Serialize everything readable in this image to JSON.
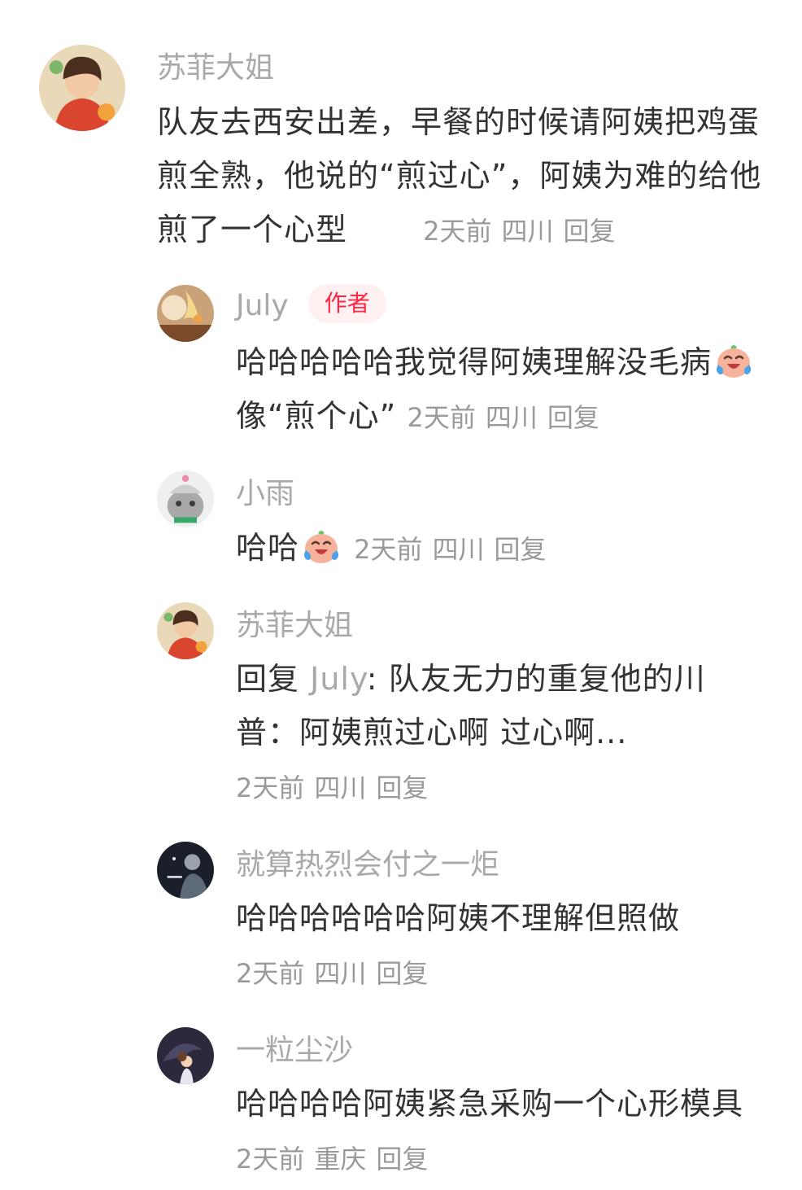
{
  "comments": [
    {
      "username": "苏菲大姐",
      "text": "队友去西安出差，早餐的时候请阿姨把鸡蛋煎全熟，他说的“煎过心”，阿姨为难的给他煎了一个心型",
      "time": "2天前",
      "location": "四川",
      "reply_label": "回复"
    },
    {
      "username": "July",
      "badge": "作者",
      "text_before_emoji": "哈哈哈哈哈我觉得阿姨理解没毛病",
      "emoji": "laugh-cry-emoji",
      "text_after_emoji": "像“煎个心”",
      "time": "2天前",
      "location": "四川",
      "reply_label": "回复"
    },
    {
      "username": "小雨",
      "text": "哈哈",
      "emoji": "laugh-cry-emoji",
      "time": "2天前",
      "location": "四川",
      "reply_label": "回复"
    },
    {
      "username": "苏菲大姐",
      "reply_prefix": "回复",
      "reply_to": "July",
      "text": ": 队友无力的重复他的川普：阿姨煎过心啊 过心啊...",
      "time": "2天前",
      "location": "四川",
      "reply_label": "回复"
    },
    {
      "username": "就算热烈会付之一炬",
      "text": "哈哈哈哈哈哈阿姨不理解但照做",
      "time": "2天前",
      "location": "四川",
      "reply_label": "回复"
    },
    {
      "username": "一粒尘沙",
      "text": "哈哈哈哈阿姨紧急采购一个心形模具",
      "time": "2天前",
      "location": "重庆",
      "reply_label": "回复"
    }
  ],
  "colors": {
    "author_badge_text": "#ff2442",
    "author_badge_bg": "#fff0f2",
    "username": "#a9a9a9",
    "body_text": "#333333",
    "meta": "#9a9a9a"
  }
}
